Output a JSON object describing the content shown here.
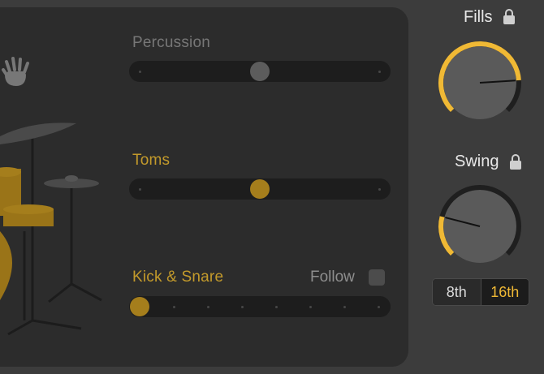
{
  "colors": {
    "accent": "#f0b935",
    "drum_gold": "#9a7418",
    "muted_label": "#777777"
  },
  "icons": {
    "hand": "hand-clap-icon",
    "drum_kit": "drum-kit-illustration",
    "lock": "lock-icon"
  },
  "tracks": [
    {
      "label": "Percussion",
      "active": false,
      "value": 0.5
    },
    {
      "label": "Toms",
      "active": true,
      "value": 0.5
    },
    {
      "label": "Kick & Snare",
      "active": true,
      "value": 0.0
    }
  ],
  "follow": {
    "label": "Follow",
    "checked": false
  },
  "fills": {
    "title": "Fills",
    "locked": true,
    "value": 0.82
  },
  "swing": {
    "title": "Swing",
    "locked": true,
    "value": 0.22
  },
  "note_value": {
    "options": [
      "8th",
      "16th"
    ],
    "selected": "16th"
  }
}
